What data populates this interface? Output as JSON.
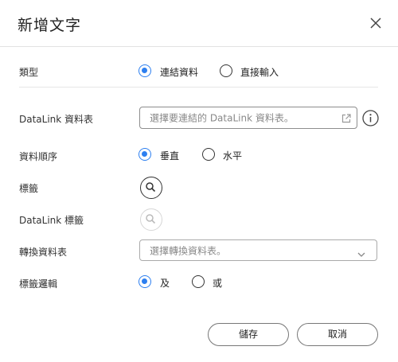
{
  "dialog": {
    "title": "新增文字"
  },
  "form": {
    "type": {
      "label": "類型",
      "options": [
        "連結資料",
        "直接輸入"
      ],
      "selected": 0
    },
    "datalink_table": {
      "label": "DataLink 資料表",
      "placeholder": "選擇要連結的 DataLink 資料表。"
    },
    "data_order": {
      "label": "資料順序",
      "options": [
        "垂直",
        "水平"
      ],
      "selected": 0
    },
    "tag": {
      "label": "標籤"
    },
    "datalink_tag": {
      "label": "DataLink 標籤"
    },
    "convert_table": {
      "label": "轉換資料表",
      "placeholder": "選擇轉換資料表。"
    },
    "tag_logic": {
      "label": "標籤邏輯",
      "options": [
        "及",
        "或"
      ],
      "selected": 0
    }
  },
  "footer": {
    "save_label": "儲存",
    "cancel_label": "取消"
  },
  "colors": {
    "accent": "#2d7ff0",
    "border": "#8d8d8d"
  },
  "icons": [
    "close-icon",
    "external-link-icon",
    "info-icon",
    "search-icon",
    "chevron-down-icon"
  ]
}
